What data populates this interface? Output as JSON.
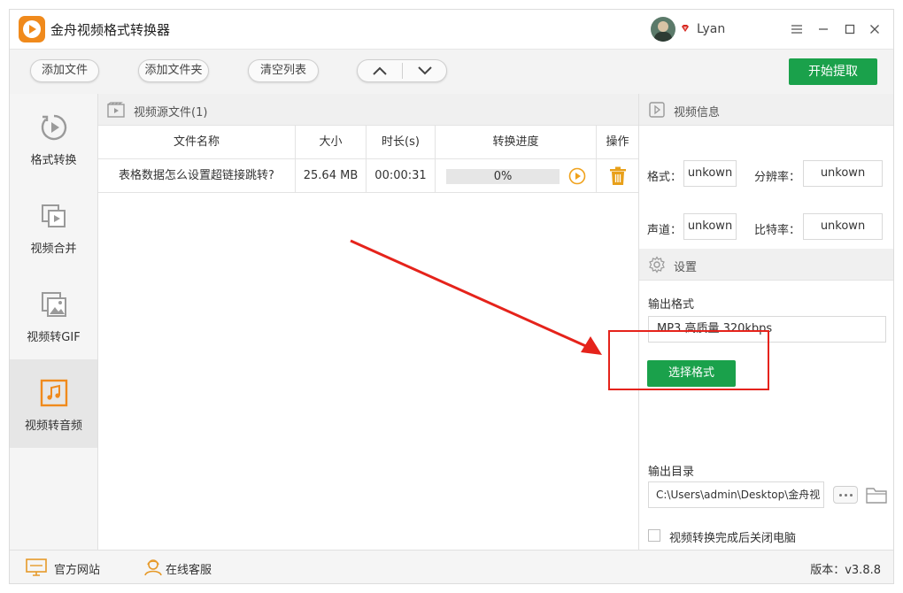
{
  "app": {
    "title": "金舟视频格式转换器",
    "username": "Lyan",
    "accent_color": "#1aa14b",
    "brand_color": "#f08a1c",
    "window_buttons": [
      "menu-icon",
      "minimize-icon",
      "maximize-icon",
      "close-icon"
    ]
  },
  "toolbar": {
    "add_file": "添加文件",
    "add_folder": "添加文件夹",
    "clear_list": "清空列表",
    "move_up_icon": "chevron-up-icon",
    "move_down_icon": "chevron-down-icon",
    "start": "开始提取"
  },
  "sidebar": {
    "items": [
      {
        "label": "格式转换",
        "icon": "format-convert-icon",
        "active": false
      },
      {
        "label": "视频合并",
        "icon": "video-merge-icon",
        "active": false
      },
      {
        "label": "视频转GIF",
        "icon": "video-to-gif-icon",
        "active": false
      },
      {
        "label": "视频转音频",
        "icon": "music-note-icon",
        "active": true
      }
    ]
  },
  "file_panel": {
    "title": "视频源文件(1)",
    "columns": [
      "文件名称",
      "大小",
      "时长(s)",
      "转换进度",
      "操作"
    ],
    "rows": [
      {
        "name": "表格数据怎么设置超链接跳转?",
        "size": "25.64 MB",
        "duration": "00:00:31",
        "progress": "0%"
      }
    ]
  },
  "video_info": {
    "title": "视频信息",
    "format_label": "格式：",
    "format_value": "unkown",
    "resolution_label": "分辨率：",
    "resolution_value": "unkown",
    "channel_label": "声道：",
    "channel_value": "unkown",
    "bitrate_label": "比特率：",
    "bitrate_value": "unkown"
  },
  "settings": {
    "title": "设置",
    "output_format_label": "输出格式",
    "output_format_value": "MP3 高质量 320kbps",
    "select_format_button": "选择格式",
    "output_dir_label": "输出目录",
    "output_dir_value": "C:\\Users\\admin\\Desktop\\金舟视",
    "shutdown_label": "视频转换完成后关闭电脑",
    "shutdown_checked": false
  },
  "footer": {
    "website": "官方网站",
    "support": "在线客服",
    "version": "版本：v3.8.8"
  },
  "annotation": {
    "color": "#e5231b"
  }
}
